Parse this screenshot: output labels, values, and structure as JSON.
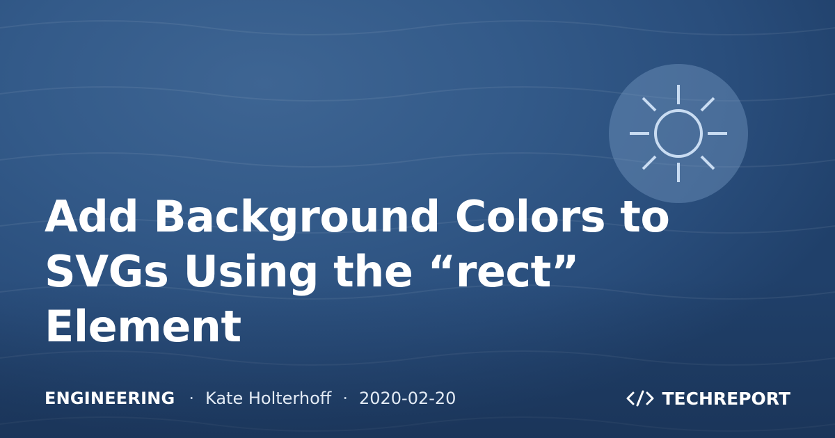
{
  "title_lines": [
    "Add Background Colors to",
    "SVGs Using the “rect”",
    "Element"
  ],
  "meta": {
    "category": "ENGINEERING",
    "separator": "·",
    "author": "Kate Holterhoff",
    "date": "2020-02-20"
  },
  "brand": {
    "icon": "code-brackets-icon",
    "name": "TECHREPORT"
  },
  "badge_icon": "sun-icon",
  "colors": {
    "background": "#335a89",
    "badge": "#7a9bc3",
    "sun_stroke": "#c9dcf2",
    "text": "#ffffff"
  }
}
